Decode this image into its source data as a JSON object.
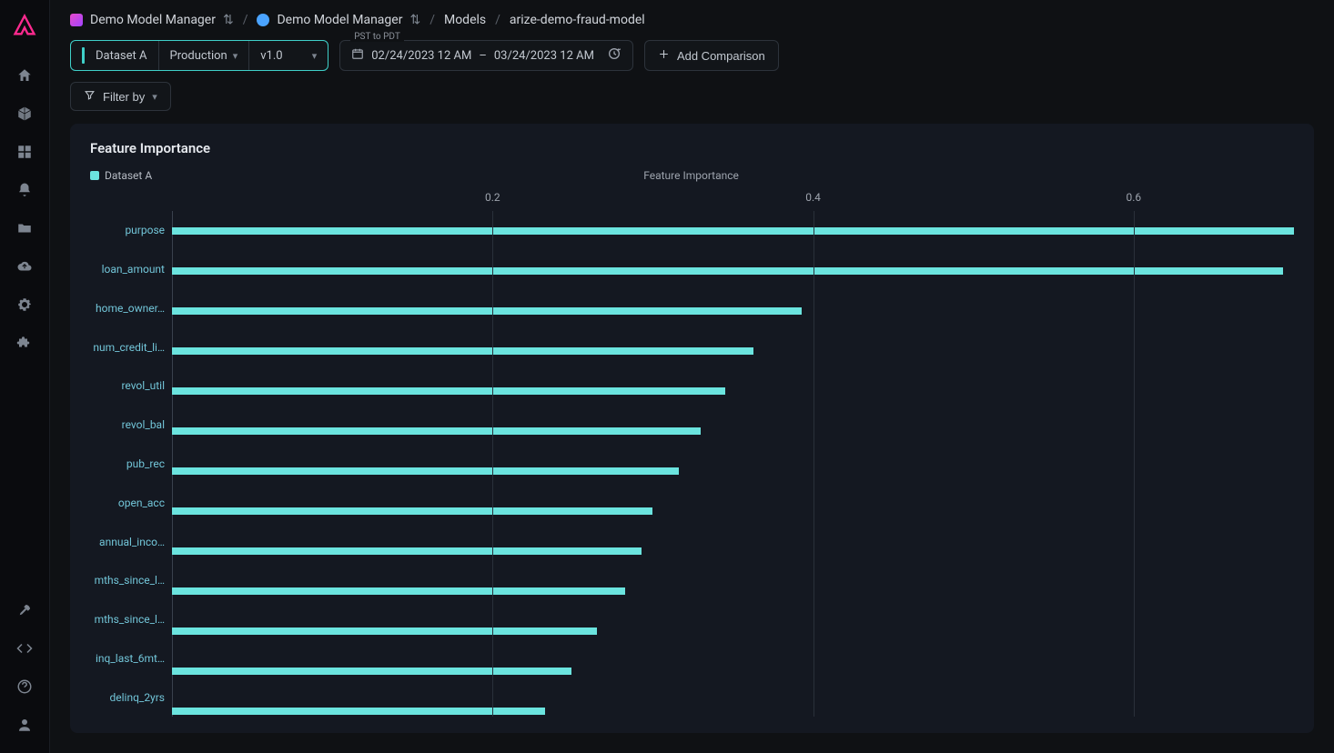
{
  "breadcrumb": {
    "org": "Demo Model Manager",
    "space": "Demo Model Manager",
    "section": "Models",
    "model": "arize-demo-fraud-model"
  },
  "toolbar": {
    "dataset_label": "Dataset A",
    "env_label": "Production",
    "version_label": "v1.0",
    "tz_label": "PST to PDT",
    "date_start": "02/24/2023 12 AM",
    "date_sep": "–",
    "date_end": "03/24/2023 12 AM",
    "add_comparison": "Add Comparison",
    "filter_by": "Filter by"
  },
  "panel": {
    "title": "Feature Importance",
    "legend_a": "Dataset A",
    "subtitle": "Feature Importance"
  },
  "chart_data": {
    "type": "bar",
    "orientation": "horizontal",
    "title": "Feature Importance",
    "xlabel": "Feature Importance",
    "ylabel": "",
    "xlim": [
      0,
      0.7
    ],
    "xticks": [
      0.2,
      0.4,
      0.6
    ],
    "series": [
      {
        "name": "Dataset A",
        "color": "#6be4df"
      }
    ],
    "categories": [
      "purpose",
      "loan_amount",
      "home_owner…",
      "num_credit_li…",
      "revol_util",
      "revol_bal",
      "pub_rec",
      "open_acc",
      "annual_inco…",
      "mths_since_l…",
      "mths_since_l…",
      "inq_last_6mt…",
      "delinq_2yrs"
    ],
    "values": [
      0.7,
      0.693,
      0.393,
      0.363,
      0.345,
      0.33,
      0.316,
      0.3,
      0.293,
      0.283,
      0.265,
      0.249,
      0.233
    ]
  }
}
